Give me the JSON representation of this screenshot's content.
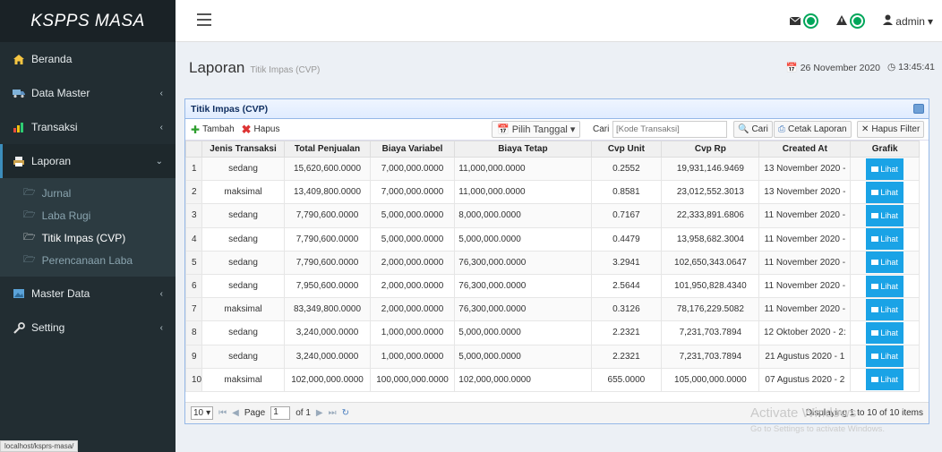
{
  "app": {
    "brand": "KSPPS MASA"
  },
  "sidebar": {
    "items": [
      {
        "label": "Beranda",
        "icon": "home-icon",
        "expandable": false
      },
      {
        "label": "Data Master",
        "icon": "truck-icon",
        "expandable": true
      },
      {
        "label": "Transaksi",
        "icon": "chart-icon",
        "expandable": true
      },
      {
        "label": "Laporan",
        "icon": "printer-icon",
        "expandable": true,
        "open": true
      },
      {
        "label": "Master Data",
        "icon": "image-icon",
        "expandable": true
      },
      {
        "label": "Setting",
        "icon": "wrench-icon",
        "expandable": true
      }
    ],
    "laporan_sub": [
      {
        "label": "Jurnal"
      },
      {
        "label": "Laba Rugi"
      },
      {
        "label": "Titik Impas (CVP)",
        "active": true
      },
      {
        "label": "Perencanaan Laba"
      }
    ],
    "status_url": "localhost/ksprs-masa/"
  },
  "topbar": {
    "user": "admin"
  },
  "page": {
    "title": "Laporan",
    "subtitle": "Titik Impas (CVP)",
    "date": "26 November 2020",
    "time": "13:45:41"
  },
  "panel": {
    "title": "Titik Impas (CVP)",
    "toolbar": {
      "add": "Tambah",
      "delete": "Hapus",
      "date_picker": "Pilih Tanggal",
      "search_label": "Cari :",
      "search_placeholder": "[Kode Transaksi]",
      "search_btn": "Cari",
      "print_btn": "Cetak Laporan",
      "clear_btn": "Hapus Filter"
    },
    "columns": [
      "Jenis Transaksi",
      "Total Penjualan",
      "Biaya Variabel",
      "Biaya Tetap",
      "Cvp Unit",
      "Cvp Rp",
      "Created At",
      "Grafik"
    ],
    "action_label": "Lihat",
    "rows": [
      {
        "no": "1",
        "jenis": "sedang",
        "penjualan": "15,620,600.0000",
        "variabel": "7,000,000.0000",
        "tetap": "11,000,000.0000",
        "unit": "0.2552",
        "rp": "19,931,146.9469",
        "created": "13 November 2020 -"
      },
      {
        "no": "2",
        "jenis": "maksimal",
        "penjualan": "13,409,800.0000",
        "variabel": "7,000,000.0000",
        "tetap": "11,000,000.0000",
        "unit": "0.8581",
        "rp": "23,012,552.3013",
        "created": "13 November 2020 -"
      },
      {
        "no": "3",
        "jenis": "sedang",
        "penjualan": "7,790,600.0000",
        "variabel": "5,000,000.0000",
        "tetap": "8,000,000.0000",
        "unit": "0.7167",
        "rp": "22,333,891.6806",
        "created": "11 November 2020 -"
      },
      {
        "no": "4",
        "jenis": "sedang",
        "penjualan": "7,790,600.0000",
        "variabel": "5,000,000.0000",
        "tetap": "5,000,000.0000",
        "unit": "0.4479",
        "rp": "13,958,682.3004",
        "created": "11 November 2020 -"
      },
      {
        "no": "5",
        "jenis": "sedang",
        "penjualan": "7,790,600.0000",
        "variabel": "2,000,000.0000",
        "tetap": "76,300,000.0000",
        "unit": "3.2941",
        "rp": "102,650,343.0647",
        "created": "11 November 2020 -"
      },
      {
        "no": "6",
        "jenis": "sedang",
        "penjualan": "7,950,600.0000",
        "variabel": "2,000,000.0000",
        "tetap": "76,300,000.0000",
        "unit": "2.5644",
        "rp": "101,950,828.4340",
        "created": "11 November 2020 -"
      },
      {
        "no": "7",
        "jenis": "maksimal",
        "penjualan": "83,349,800.0000",
        "variabel": "2,000,000.0000",
        "tetap": "76,300,000.0000",
        "unit": "0.3126",
        "rp": "78,176,229.5082",
        "created": "11 November 2020 -"
      },
      {
        "no": "8",
        "jenis": "sedang",
        "penjualan": "3,240,000.0000",
        "variabel": "1,000,000.0000",
        "tetap": "5,000,000.0000",
        "unit": "2.2321",
        "rp": "7,231,703.7894",
        "created": "12 Oktober 2020 - 2:"
      },
      {
        "no": "9",
        "jenis": "sedang",
        "penjualan": "3,240,000.0000",
        "variabel": "1,000,000.0000",
        "tetap": "5,000,000.0000",
        "unit": "2.2321",
        "rp": "7,231,703.7894",
        "created": "21 Agustus 2020 - 1"
      },
      {
        "no": "10",
        "jenis": "maksimal",
        "penjualan": "102,000,000.0000",
        "variabel": "100,000,000.0000",
        "tetap": "102,000,000.0000",
        "unit": "655.0000",
        "rp": "105,000,000.0000",
        "created": "07 Agustus 2020 - 2"
      }
    ],
    "pager": {
      "page_size": "10",
      "page_label": "Page",
      "page": "1",
      "of_label": "of 1",
      "info": "Displaying 1 to 10 of 10 items"
    }
  },
  "watermark": {
    "line1": "Activate Windows",
    "line2": "Go to Settings to activate Windows."
  }
}
